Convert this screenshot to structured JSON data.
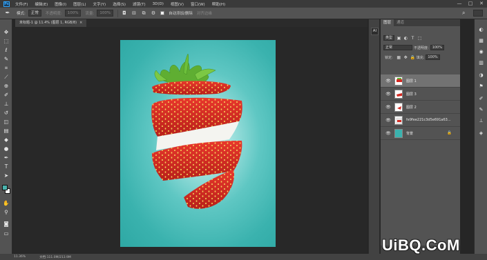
{
  "app": {
    "logo_text": "Ps"
  },
  "menubar": {
    "items": [
      "文件(F)",
      "编辑(E)",
      "图像(I)",
      "图层(L)",
      "文字(Y)",
      "选择(S)",
      "滤镜(T)",
      "3D(D)",
      "视图(V)",
      "窗口(W)",
      "帮助(H)"
    ],
    "window_controls": [
      "—",
      "□",
      "✕"
    ]
  },
  "options_bar": {
    "mode_label": "模式:",
    "mode_value": "正常",
    "opacity_label": "不透明度:",
    "opacity_value": "100%",
    "flow_label": "流量:",
    "flow_value": "100%",
    "auto_select_label": "自动添加/删除",
    "align_label": "对齐边缘"
  },
  "document_tab": {
    "title": "未标题-1 @ 11.4% (图层 1, RGB/8)",
    "close": "×"
  },
  "right_strip": {
    "ai_label": "AI"
  },
  "layers_panel": {
    "tabs": [
      "图层",
      "通道"
    ],
    "kind_filter": "类型",
    "blend_mode": "正常",
    "opacity_label": "不透明度:",
    "opacity_value": "100%",
    "lock_label": "锁定:",
    "fill_label": "填充:",
    "fill_value": "100%",
    "layers": [
      {
        "name": "图层 1",
        "selected": true,
        "thumb": "strawberry-top",
        "visible": true,
        "locked": false
      },
      {
        "name": "图层 3",
        "selected": false,
        "thumb": "strawberry-slice",
        "visible": true,
        "locked": false
      },
      {
        "name": "图层 2",
        "selected": false,
        "thumb": "strawberry-slice",
        "visible": true,
        "locked": false
      },
      {
        "name": "fe9fee221c3d5e691a63...",
        "selected": false,
        "thumb": "image",
        "visible": true,
        "locked": false
      },
      {
        "name": "背景",
        "selected": false,
        "thumb": "teal",
        "visible": true,
        "locked": true
      }
    ]
  },
  "status_bar": {
    "zoom": "11.36%",
    "doc_info": "文档:111.0M/213.9M"
  },
  "colors": {
    "foreground": "#4ab3ad",
    "background": "#ffffff",
    "canvas_teal": "#2ea8a4",
    "strawberry_red": "#d42a22",
    "leaf_green": "#5fae32"
  },
  "watermark": {
    "text": "UiBQ.CoM"
  }
}
